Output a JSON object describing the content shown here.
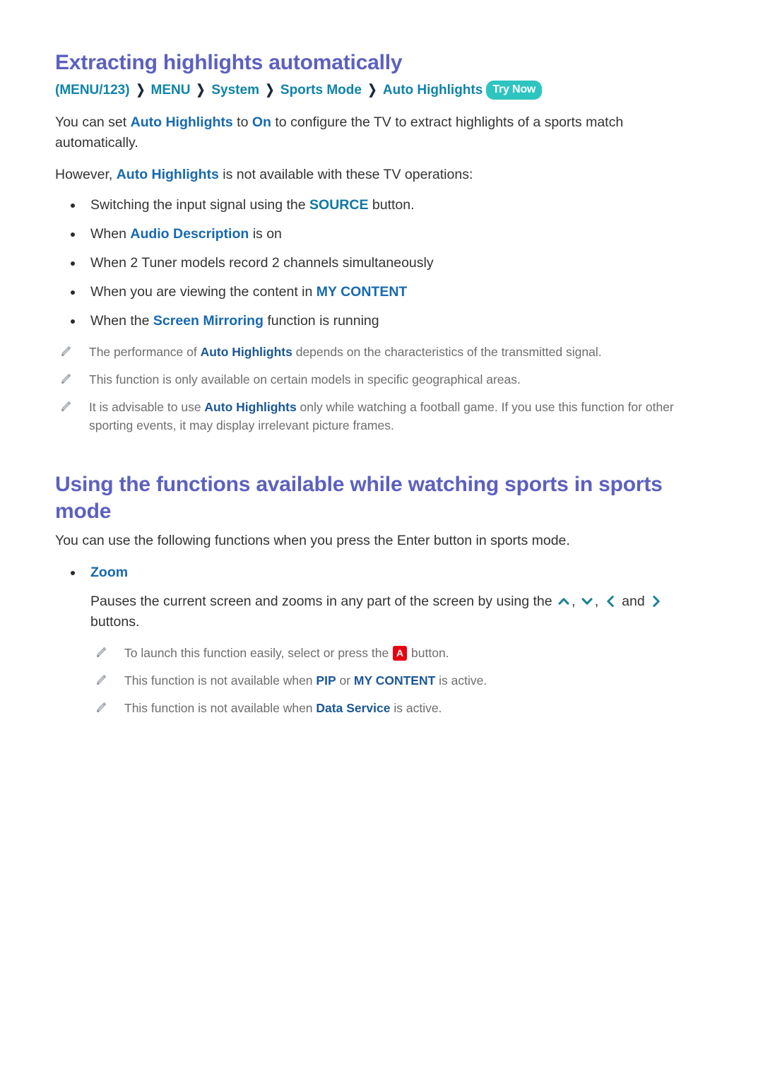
{
  "document": {
    "colors": {
      "heading": "#5c60bf",
      "breadcrumb": "#0f83a8",
      "link": "#1769b0",
      "link_alt": "#10789f",
      "link_dark": "#1b5795",
      "body": "#333333",
      "note": "#6d6d6d",
      "badge_bg": "#2ec4c0",
      "key_a_bg": "#e60012"
    }
  },
  "section1": {
    "title": "Extracting highlights automatically",
    "breadcrumb": {
      "items": [
        "(MENU/123)",
        "MENU",
        "System",
        "Sports Mode",
        "Auto Highlights"
      ],
      "separator": "❯",
      "badge": "Try Now"
    },
    "intro": {
      "part1": "You can set ",
      "link1": "Auto Highlights",
      "part2": " to ",
      "link2": "On",
      "part3": " to configure the TV to extract highlights of a sports match automatically."
    },
    "however": {
      "part1": "However, ",
      "link1": "Auto Highlights",
      "part2": " is not available with these TV operations:"
    },
    "bullets": [
      {
        "part1": "Switching the input signal using the ",
        "link": "SOURCE",
        "link_style": "alt",
        "part2": " button."
      },
      {
        "part1": "When ",
        "link": "Audio Description",
        "link_style": "normal",
        "part2": " is on"
      },
      {
        "part1": "When 2 Tuner models record 2 channels simultaneously",
        "link": "",
        "link_style": "none",
        "part2": ""
      },
      {
        "part1": "When you are viewing the content in ",
        "link": "MY CONTENT",
        "link_style": "normal",
        "part2": ""
      },
      {
        "part1": "When the ",
        "link": "Screen Mirroring",
        "link_style": "normal",
        "part2": " function is running"
      }
    ],
    "notes": [
      {
        "part1": "The performance of ",
        "link": "Auto Highlights",
        "part2": " depends on the characteristics of the transmitted signal."
      },
      {
        "part1": "This function is only available on certain models in specific geographical areas.",
        "link": "",
        "part2": ""
      },
      {
        "part1": "It is advisable to use ",
        "link": "Auto Highlights",
        "part2": " only while watching a football game. If you use this function for other sporting events, it may display irrelevant picture frames."
      }
    ]
  },
  "section2": {
    "title": "Using the functions available while watching sports in sports mode",
    "intro": "You can use the following functions when you press the Enter button in sports mode.",
    "zoom_bullet": "Zoom",
    "zoom_description": {
      "part1": "Pauses the current screen and zooms in any part of the screen by using the ",
      "arrow_up": "chevron-up-icon",
      "sep1": ", ",
      "arrow_down": "chevron-down-icon",
      "sep2": ", ",
      "arrow_left": "chevron-left-icon",
      "sep3": " and ",
      "arrow_right": "chevron-right-icon",
      "part2": " buttons."
    },
    "notes": [
      {
        "part1": "To launch this function easily, select or press the ",
        "key": "A",
        "part2": " button."
      },
      {
        "part1": "This function is not available when ",
        "link1": "PIP",
        "mid": " or ",
        "link2": "MY CONTENT",
        "part2": " is active."
      },
      {
        "part1": "This function is not available when ",
        "link1": "Data Service",
        "mid": "",
        "link2": "",
        "part2": " is active."
      }
    ]
  }
}
